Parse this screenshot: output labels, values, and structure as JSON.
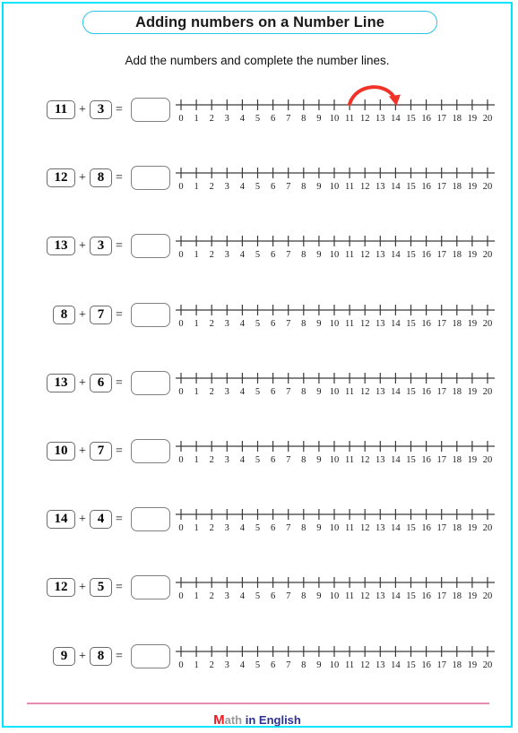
{
  "header": {
    "title": "Adding numbers on a Number Line",
    "subtitle": "Add the numbers and complete  the number lines."
  },
  "colors": {
    "page_border": "#00E5FF",
    "title_border": "#29C5E8",
    "arc_red": "#F03228",
    "footer_rule": "#E88BB0",
    "logo_m": "#ED1C24",
    "logo_ath": "#9a9a9a",
    "logo_rest": "#2E3192",
    "box_border": "#6b6b6b",
    "answer_border": "#808080"
  },
  "number_line": {
    "min": 0,
    "max": 20,
    "tick_labels": [
      "0",
      "1",
      "2",
      "3",
      "4",
      "5",
      "6",
      "7",
      "8",
      "9",
      "10",
      "11",
      "12",
      "13",
      "14",
      "15",
      "16",
      "17",
      "18",
      "19",
      "20"
    ]
  },
  "symbols": {
    "plus": "+",
    "equals": "="
  },
  "problems": [
    {
      "a": "11",
      "b": "3",
      "answer": "",
      "arc": {
        "from": 11,
        "to": 14
      }
    },
    {
      "a": "12",
      "b": "8",
      "answer": "",
      "arc": null
    },
    {
      "a": "13",
      "b": "3",
      "answer": "",
      "arc": null
    },
    {
      "a": "8",
      "b": "7",
      "answer": "",
      "arc": null
    },
    {
      "a": "13",
      "b": "6",
      "answer": "",
      "arc": null
    },
    {
      "a": "10",
      "b": "7",
      "answer": "",
      "arc": null
    },
    {
      "a": "14",
      "b": "4",
      "answer": "",
      "arc": null
    },
    {
      "a": "12",
      "b": "5",
      "answer": "",
      "arc": null
    },
    {
      "a": "9",
      "b": "8",
      "answer": "",
      "arc": null
    }
  ],
  "footer": {
    "logo_m": "M",
    "logo_ath": "ath",
    "logo_rest": " in English"
  }
}
